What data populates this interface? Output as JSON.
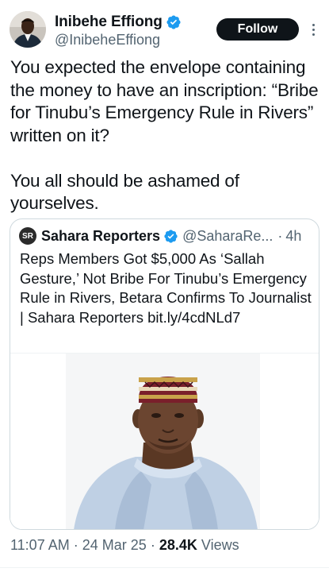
{
  "tweet": {
    "author": {
      "display_name": "Inibehe Effiong",
      "handle": "@InibeheEffiong",
      "verified": true,
      "avatar_icon": "avatar"
    },
    "follow_label": "Follow",
    "paragraphs": [
      "You expected the envelope containing the money to have an inscription: “Bribe for Tinubu’s Emergency Rule in Rivers” written on it?",
      "You all should be ashamed of yourselves."
    ],
    "time": "11:07 AM",
    "separator": "·",
    "date": "24 Mar 25",
    "views_count": "28.4K",
    "views_label": "Views"
  },
  "quoted_tweet": {
    "avatar_text": "SR",
    "display_name": "Sahara Reporters",
    "verified": true,
    "handle": "@SaharaRe...",
    "separator": "·",
    "age": "4h",
    "text": "Reps Members Got $5,000 As ‘Sallah Gesture,’ Not Bribe For Tinubu’s Emergency Rule in Rivers, Betara Confirms To Journalist | Sahara Reporters bit.ly/4cdNLd7",
    "image_icon": "photo-portrait"
  },
  "colors": {
    "verified_blue": "#1d9bf0",
    "text_primary": "#0f1419",
    "text_secondary": "#536471",
    "border": "#cfd9de"
  }
}
